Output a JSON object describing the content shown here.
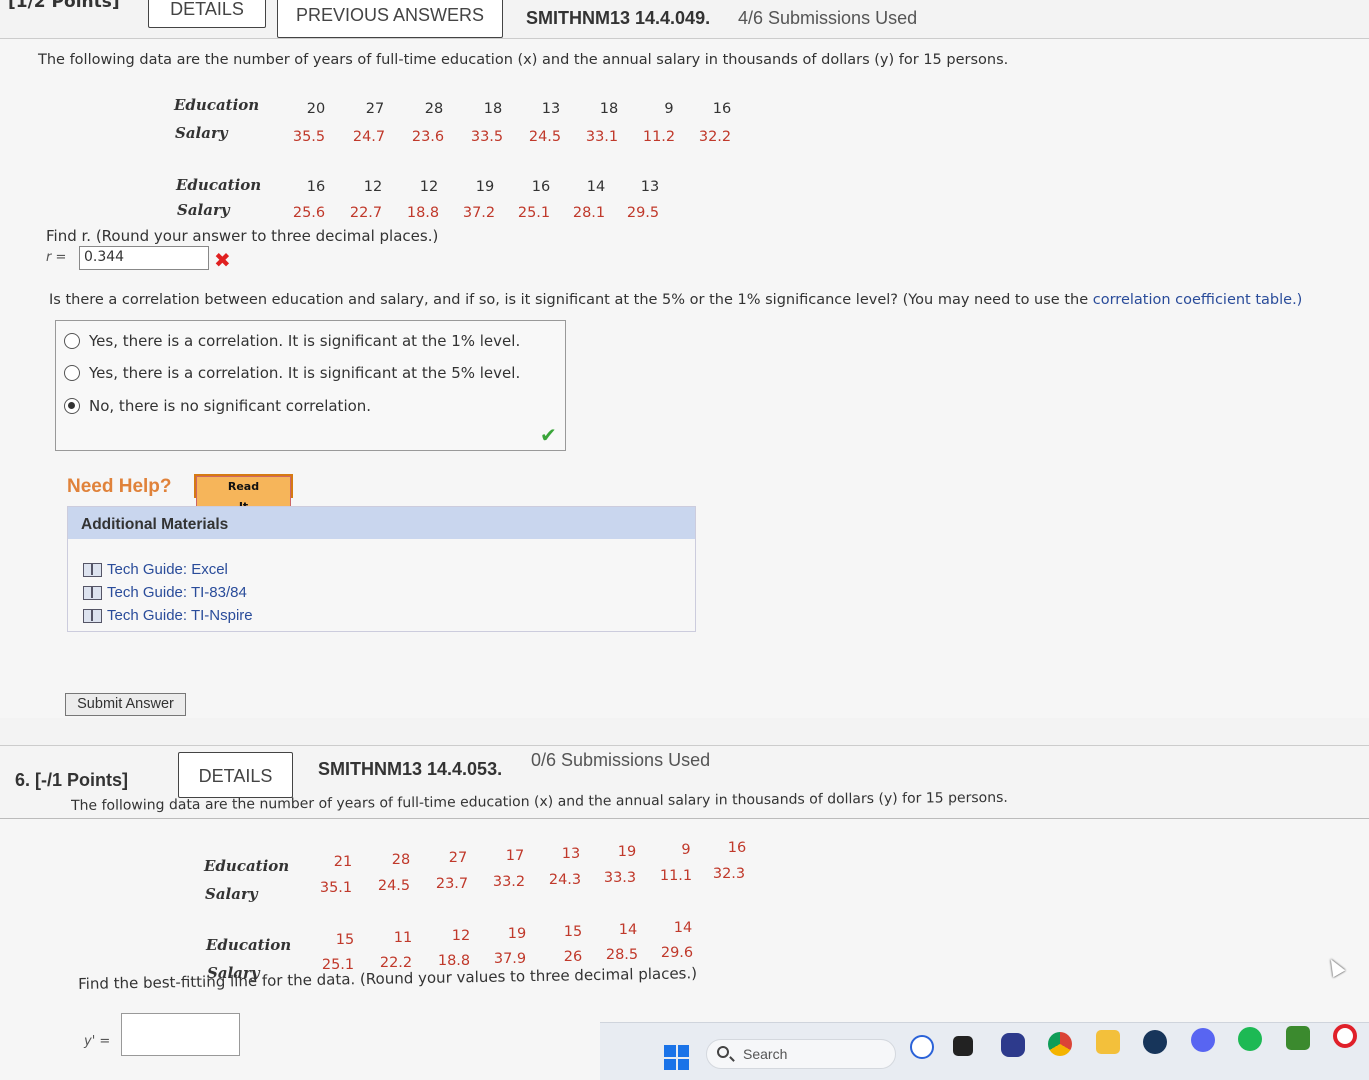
{
  "problem5": {
    "points": "[1/2 Points]",
    "details_label": "DETAILS",
    "prev_answers_label": "PREVIOUS ANSWERS",
    "qid": "SMITHNM13 14.4.049.",
    "submissions": "4/6 Submissions Used",
    "intro": "The following data are the number of years of full-time education (x) and the annual salary in thousands of dollars (y) for 15 persons.",
    "row_label_education": "Education",
    "row_label_salary": "Salary",
    "table1": {
      "education": [
        "20",
        "27",
        "28",
        "18",
        "13",
        "18",
        "9",
        "16"
      ],
      "salary": [
        "35.5",
        "24.7",
        "23.6",
        "33.5",
        "24.5",
        "33.1",
        "11.2",
        "32.2"
      ]
    },
    "table2": {
      "education": [
        "16",
        "12",
        "12",
        "19",
        "16",
        "14",
        "13"
      ],
      "salary": [
        "25.6",
        "22.7",
        "18.8",
        "37.2",
        "25.1",
        "28.1",
        "29.5"
      ]
    },
    "find_r": "Find r. (Round your answer to three decimal places.)",
    "r_label": "r =",
    "r_value": "0.344",
    "wrong_mark": "✖",
    "question2": "Is there a correlation between education and salary, and if so, is it significant at the 5% or the 1% significance level? (You may need to use the ",
    "question2_link": "correlation coefficient table.)",
    "choices": [
      "Yes, there is a correlation. It is significant at the 1% level.",
      "Yes, there is a correlation. It is significant at the 5% level.",
      "No, there is no significant correlation."
    ],
    "selected_choice": 2,
    "correct_mark": "✔",
    "need_help": "Need Help?",
    "read_it": "Read It",
    "additional_materials": "Additional Materials",
    "links": [
      "Tech Guide: Excel",
      "Tech Guide: TI-83/84",
      "Tech Guide: TI-Nspire"
    ],
    "submit": "Submit Answer"
  },
  "problem6": {
    "title": "6.  [-/1 Points]",
    "details_label": "DETAILS",
    "qid": "SMITHNM13 14.4.053.",
    "submissions": "0/6 Submissions Used",
    "intro": "The following data are the number of years of full-time education (x) and the annual salary in thousands of dollars (y) for 15 persons.",
    "row_label_education": "Education",
    "row_label_salary": "Salary",
    "table1": {
      "education": [
        "21",
        "28",
        "27",
        "17",
        "13",
        "19",
        "9",
        "16"
      ],
      "salary": [
        "35.1",
        "24.5",
        "23.7",
        "33.2",
        "24.3",
        "33.3",
        "11.1",
        "32.3"
      ]
    },
    "table2": {
      "education": [
        "15",
        "11",
        "12",
        "19",
        "15",
        "14",
        "14"
      ],
      "salary": [
        "25.1",
        "22.2",
        "18.8",
        "37.9",
        "26",
        "28.5",
        "29.6"
      ]
    },
    "find_line": "Find the best-fitting line for the data. (Round your values to three decimal places.)",
    "y_label": "y' =",
    "y_value": ""
  },
  "taskbar": {
    "search_placeholder": "Search"
  },
  "colors": {
    "data_red": "#c0392b",
    "link_blue": "#2a4c9a",
    "help_orange": "#e0823a",
    "wrong_red": "#e02020",
    "correct_green": "#3aa53a"
  }
}
